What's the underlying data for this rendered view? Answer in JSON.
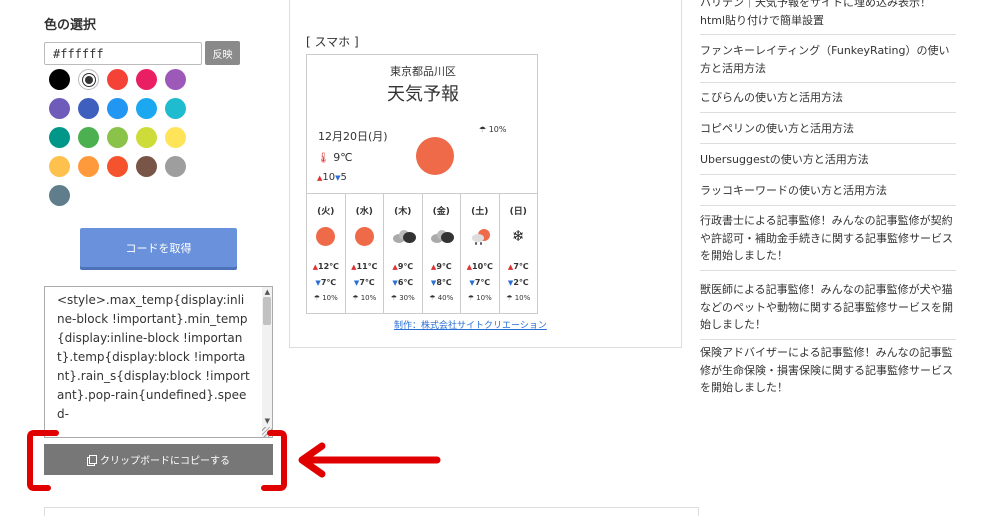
{
  "color_picker": {
    "title": "色の選択",
    "input_value": "#ffffff",
    "apply_label": "反映",
    "swatches": [
      "#000000",
      "#ffffff",
      "#f44336",
      "#e91e63",
      "#9c59b8",
      "#6e5bba",
      "#3f5fbf",
      "#2196f3",
      "#1ba8f0",
      "#1fbcd0",
      "#009688",
      "#4caf50",
      "#8bc34a",
      "#cddc39",
      "#ffe45a",
      "#ffc14d",
      "#ff9a3c",
      "#f5532d",
      "#795548",
      "#9e9e9e",
      "#607d8b"
    ],
    "selected_swatch": "#ffffff"
  },
  "get_code_label": "コードを取得",
  "code_text": "<style>.max_temp{display:inline-block !important}.min_temp{display:inline-block !important}.temp{display:block !important}.rain_s{display:block !important}.pop-rain{undefined}.speed-",
  "copy_label": "クリップボードにコピーする",
  "preview": {
    "device_label": "[ スマホ ]",
    "location": "東京都品川区",
    "title": "天気予報",
    "date": "12月20日(月)",
    "rain_chance": "10%",
    "temp": "9℃",
    "high": "10",
    "low": "5",
    "days": [
      {
        "name": "(火)",
        "icon": "sun-icon",
        "max": "12℃",
        "min": "7℃",
        "rain": "10%"
      },
      {
        "name": "(水)",
        "icon": "sun-icon",
        "max": "11℃",
        "min": "7℃",
        "rain": "10%"
      },
      {
        "name": "(木)",
        "icon": "cloud-icon",
        "max": "9℃",
        "min": "6℃",
        "rain": "30%"
      },
      {
        "name": "(金)",
        "icon": "cloud-icon",
        "max": "9℃",
        "min": "8℃",
        "rain": "40%"
      },
      {
        "name": "(土)",
        "icon": "sun-rain-icon",
        "max": "10℃",
        "min": "7℃",
        "rain": "10%"
      },
      {
        "name": "(日)",
        "icon": "snow-icon",
        "max": "7℃",
        "min": "2℃",
        "rain": "10%"
      }
    ],
    "credit": "制作：株式会社サイトクリエーション"
  },
  "sidebar_links": [
    "ハリテン｜天気予報をサイトに埋め込み表示！html貼り付けで簡単設置",
    "ファンキーレイティング（FunkeyRating）の使い方と活用方法",
    "こびらんの使い方と活用方法",
    "コピペリンの使い方と活用方法",
    "Ubersuggestの使い方と活用方法",
    "ラッコキーワードの使い方と活用方法",
    "行政書士による記事監修！みんなの記事監修が契約や許認可・補助金手続きに関する記事監修サービスを開始しました！",
    "獣医師による記事監修！みんなの記事監修が犬や猫などのペットや動物に関する記事監修サービスを開始しました！",
    "保険アドバイザーによる記事監修！みんなの記事監修が生命保険・損害保険に関する記事監修サービスを開始しました！"
  ],
  "colors": {
    "accent_button": "#6a92dc",
    "copy_button": "#777777",
    "highlight": "#e00000"
  }
}
